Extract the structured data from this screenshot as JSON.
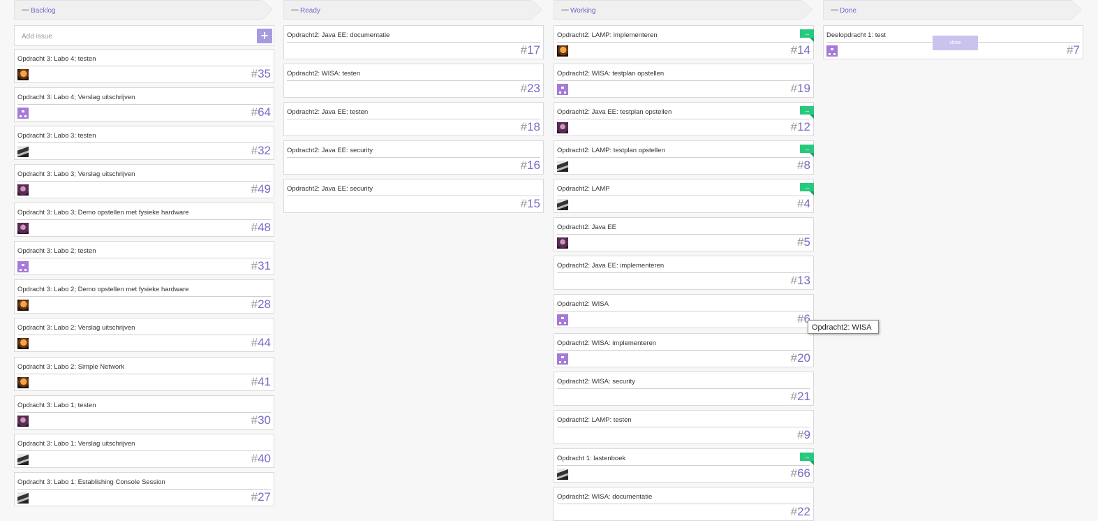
{
  "columns": [
    {
      "title": "Backlog",
      "add_placeholder": "Add issue",
      "add_icon": "plus-icon",
      "cards": [
        {
          "title": "Opdracht 3: Labo 4; testen",
          "number": "35",
          "avatar": "orange"
        },
        {
          "title": "Opdracht 3: Labo 4; Verslag uitschrijven",
          "number": "64",
          "avatar": "pixel"
        },
        {
          "title": "Opdracht 3: Labo 3; testen",
          "number": "32",
          "avatar": "gray"
        },
        {
          "title": "Opdracht 3: Labo 3; Verslag uitschrijven",
          "number": "49",
          "avatar": "purple"
        },
        {
          "title": "Opdracht 3: Labo 3; Demo opstellen met fysieke hardware",
          "number": "48",
          "avatar": "purple"
        },
        {
          "title": "Opdracht 3: Labo 2; testen",
          "number": "31",
          "avatar": "pixel"
        },
        {
          "title": "Opdracht 3: Labo 2; Demo opstellen met fysieke hardware",
          "number": "28",
          "avatar": "orange"
        },
        {
          "title": "Opdracht 3: Labo 2; Verslag uitschrijven",
          "number": "44",
          "avatar": "orange"
        },
        {
          "title": "Opdracht 3: Labo 2: Simple Network",
          "number": "41",
          "avatar": "orange"
        },
        {
          "title": "Opdracht 3: Labo 1; testen",
          "number": "30",
          "avatar": "purple"
        },
        {
          "title": "Opdracht 3: Labo 1; Verslag uitschrijven",
          "number": "40",
          "avatar": "gray"
        },
        {
          "title": "Opdracht 3: Labo 1: Establishing Console Session",
          "number": "27",
          "avatar": "gray"
        }
      ]
    },
    {
      "title": "Ready",
      "cards": [
        {
          "title": "Opdracht2: Java EE: documentatie",
          "number": "17",
          "avatar": ""
        },
        {
          "title": "Opdracht2: WISA: testen",
          "number": "23",
          "avatar": ""
        },
        {
          "title": "Opdracht2: Java EE: testen",
          "number": "18",
          "avatar": ""
        },
        {
          "title": "Opdracht2: Java EE: security",
          "number": "16",
          "avatar": ""
        },
        {
          "title": "Opdracht2: Java EE: security",
          "number": "15",
          "avatar": ""
        }
      ]
    },
    {
      "title": "Working",
      "cards": [
        {
          "title": "Opdracht2: LAMP: implementeren",
          "number": "14",
          "avatar": "orange",
          "flag": true
        },
        {
          "title": "Opdracht2: WISA: testplan opstellen",
          "number": "19",
          "avatar": "pixel"
        },
        {
          "title": "Opdracht2: Java EE: testplan opstellen",
          "number": "12",
          "avatar": "purple",
          "flag": true
        },
        {
          "title": "Opdracht2: LAMP: testplan opstellen",
          "number": "8",
          "avatar": "gray",
          "flag": true
        },
        {
          "title": "Opdracht2: LAMP",
          "number": "4",
          "avatar": "gray",
          "flag": true
        },
        {
          "title": "Opdracht2: Java EE",
          "number": "5",
          "avatar": "purple"
        },
        {
          "title": "Opdracht2: Java EE: implementeren",
          "number": "13",
          "avatar": ""
        },
        {
          "title": "Opdracht2: WISA",
          "number": "6",
          "avatar": "pixel"
        },
        {
          "title": "Opdracht2: WISA: implementeren",
          "number": "20",
          "avatar": "pixel"
        },
        {
          "title": "Opdracht2: WISA: security",
          "number": "21",
          "avatar": ""
        },
        {
          "title": "Opdracht2: LAMP: testen",
          "number": "9",
          "avatar": ""
        },
        {
          "title": "Opdracht 1: lastenboek",
          "number": "66",
          "avatar": "gray",
          "flag": true
        },
        {
          "title": "Opdracht2: WISA: documentatie",
          "number": "22",
          "avatar": ""
        }
      ]
    },
    {
      "title": "Done",
      "cards": [
        {
          "title": "Deelopdracht 1: test",
          "number": "7",
          "avatar": "pixel",
          "close_label": "close"
        }
      ]
    }
  ],
  "tooltip": "Opdracht2: WISA",
  "hash": "#",
  "flag_icon": "arrow-right-icon",
  "colors": {
    "accent": "#7b68c7",
    "flag": "#27c97e",
    "add_button": "#a79ae0"
  }
}
